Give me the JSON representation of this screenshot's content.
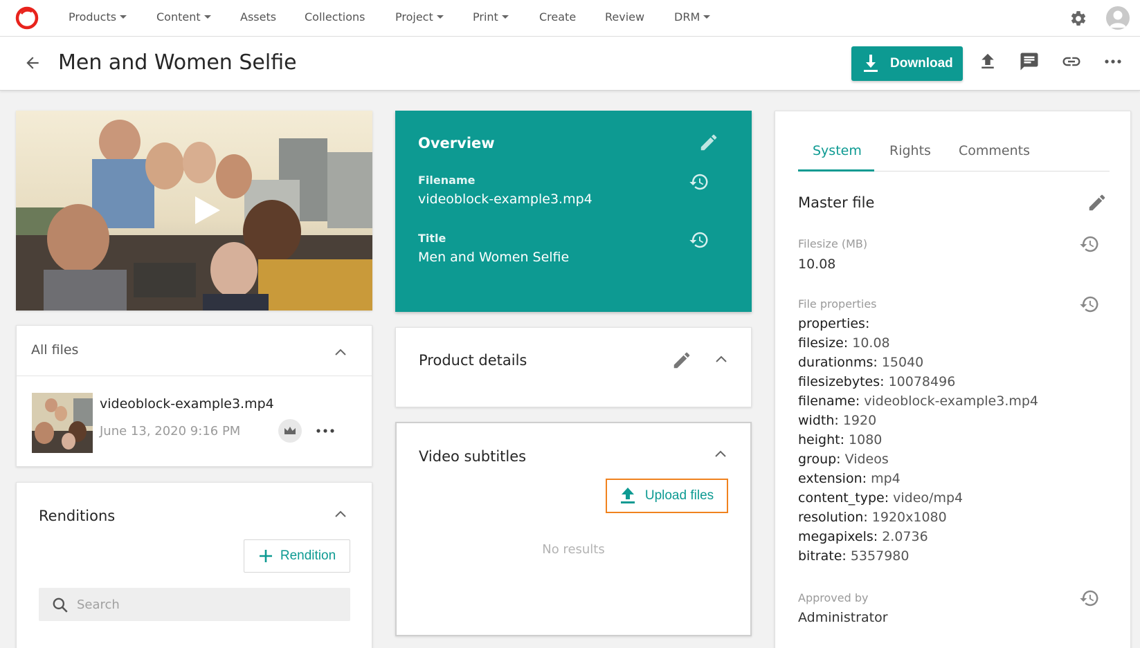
{
  "nav": {
    "items": [
      {
        "label": "Products",
        "dropdown": true
      },
      {
        "label": "Content",
        "dropdown": true
      },
      {
        "label": "Assets",
        "dropdown": false
      },
      {
        "label": "Collections",
        "dropdown": false
      },
      {
        "label": "Project",
        "dropdown": true
      },
      {
        "label": "Print",
        "dropdown": true
      },
      {
        "label": "Create",
        "dropdown": false
      },
      {
        "label": "Review",
        "dropdown": false
      },
      {
        "label": "DRM",
        "dropdown": true
      }
    ]
  },
  "header": {
    "title": "Men and Women Selfie",
    "download_label": "Download"
  },
  "all_files": {
    "heading": "All files",
    "file_name": "videoblock-example3.mp4",
    "file_date": "June 13, 2020 9:16 PM"
  },
  "renditions": {
    "heading": "Renditions",
    "add_label": "Rendition",
    "search_placeholder": "Search"
  },
  "overview": {
    "title": "Overview",
    "filename_label": "Filename",
    "filename_value": "videoblock-example3.mp4",
    "title_label": "Title",
    "title_value": "Men and Women Selfie"
  },
  "product_details": {
    "title": "Product details"
  },
  "video_subtitles": {
    "title": "Video subtitles",
    "upload_label": "Upload files",
    "empty_text": "No results"
  },
  "system_panel": {
    "tabs": [
      "System",
      "Rights",
      "Comments"
    ],
    "active_tab": "System",
    "master_file_title": "Master file",
    "filesize_label": "Filesize (MB)",
    "filesize_value": "10.08",
    "file_properties_label": "File properties",
    "properties_heading": "properties:",
    "properties": [
      {
        "key": "filesize:",
        "value": "10.08"
      },
      {
        "key": "durationms:",
        "value": "15040"
      },
      {
        "key": "filesizebytes:",
        "value": "10078496"
      },
      {
        "key": "filename:",
        "value": "videoblock-example3.mp4"
      },
      {
        "key": "width:",
        "value": "1920"
      },
      {
        "key": "height:",
        "value": "1080"
      },
      {
        "key": "group:",
        "value": "Videos"
      },
      {
        "key": "extension:",
        "value": "mp4"
      },
      {
        "key": "content_type:",
        "value": "video/mp4"
      },
      {
        "key": "resolution:",
        "value": "1920x1080"
      },
      {
        "key": "megapixels:",
        "value": "2.0736"
      },
      {
        "key": "bitrate:",
        "value": "5357980"
      }
    ],
    "approved_by_label": "Approved by",
    "approved_by_value": "Administrator"
  },
  "colors": {
    "accent": "#0d9a92",
    "logo": "#e8231c",
    "highlight": "#f0821e"
  }
}
